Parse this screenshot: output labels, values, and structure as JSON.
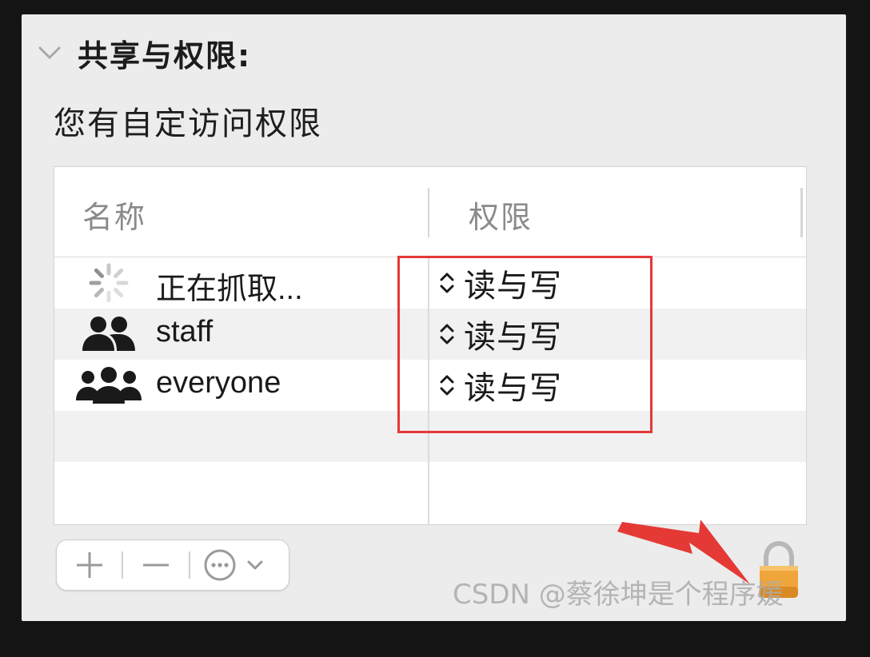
{
  "section": {
    "title": "共享与权限:",
    "description": "您有自定访问权限"
  },
  "table": {
    "headers": {
      "name": "名称",
      "permission": "权限"
    },
    "rows": [
      {
        "icon": "spinner-icon",
        "name": "正在抓取...",
        "permission": "读与写"
      },
      {
        "icon": "group-icon",
        "name": "staff",
        "permission": "读与写"
      },
      {
        "icon": "everyone-icon",
        "name": "everyone",
        "permission": "读与写"
      }
    ]
  },
  "toolbar": {
    "add": "+",
    "remove": "−",
    "more": "⋯"
  },
  "watermark": "CSDN @蔡徐坤是个程序媛",
  "colors": {
    "annotation": "#e53935",
    "lock": "#f0a53a"
  }
}
